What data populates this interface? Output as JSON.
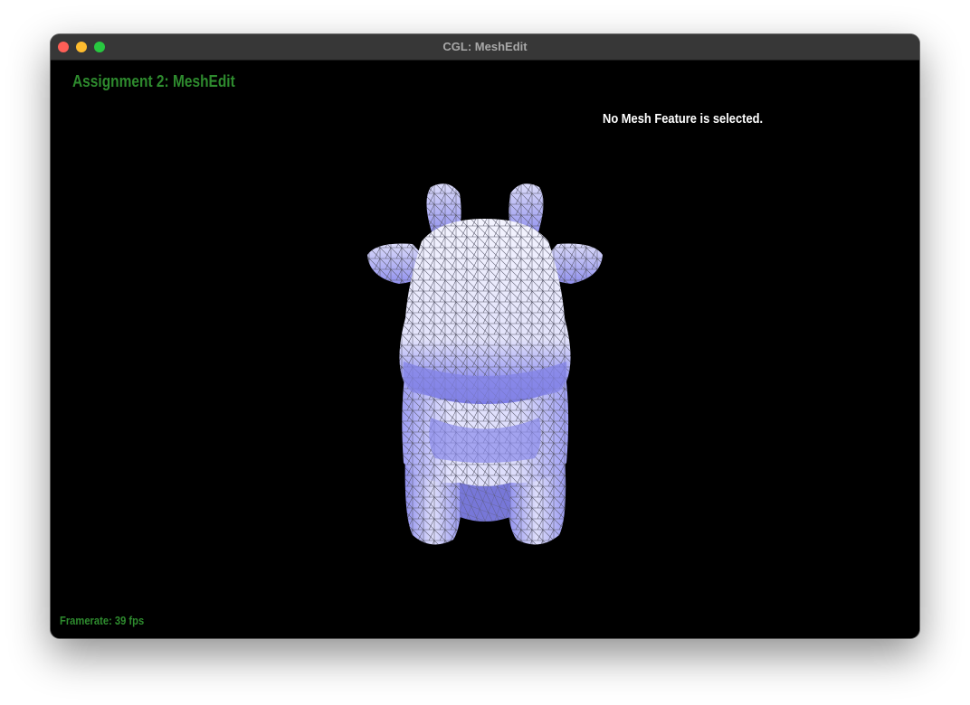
{
  "window": {
    "title": "CGL: MeshEdit"
  },
  "viewport": {
    "assignment_title": "Assignment 2: MeshEdit",
    "selection_status": "No Mesh Feature is selected.",
    "framerate": "Framerate: 39 fps",
    "model": "cow-mesh",
    "colors": {
      "label_green": "#2e8b2e",
      "mesh_fill_light": "#e9e9ff",
      "mesh_fill_shadow": "#8b8bf0",
      "wireframe": "#555566",
      "background": "#000000"
    }
  }
}
